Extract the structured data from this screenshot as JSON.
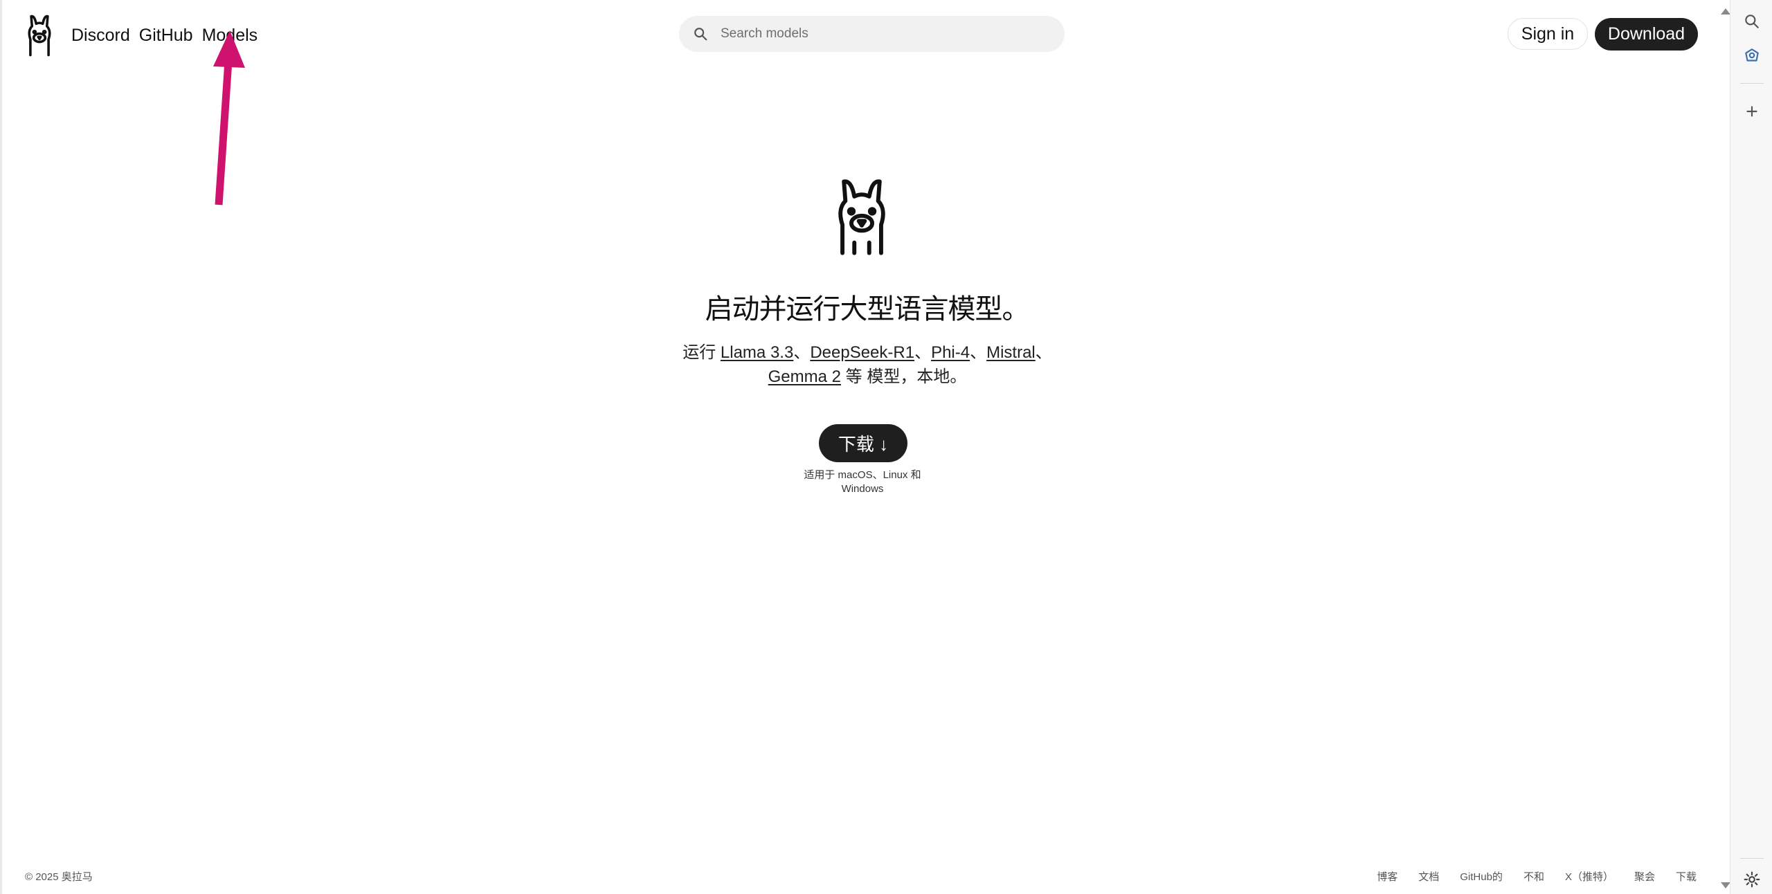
{
  "header": {
    "nav": [
      "Discord",
      "GitHub",
      "Models"
    ],
    "search_placeholder": "Search models",
    "signin_label": "Sign in",
    "download_label": "Download"
  },
  "hero": {
    "headline": "启动并运行大型语言模型。",
    "run_prefix": "运行 ",
    "models": [
      "Llama 3.3",
      "DeepSeek-R1",
      "Phi-4",
      "Mistral",
      "Gemma 2"
    ],
    "separator": "、",
    "run_suffix": " 等 模型，本地。",
    "download_button": "下载 ↓",
    "platforms_line1": "适用于 macOS、Linux 和",
    "platforms_line2": "Windows"
  },
  "footer": {
    "copyright": "© 2025 奥拉马",
    "links": [
      "博客",
      "文档",
      "GitHub的",
      "不和",
      "X（推特）",
      "聚会",
      "下载"
    ]
  },
  "annotation": {
    "arrow_color": "#d0126f"
  },
  "colors": {
    "button_dark": "#1f1f1f",
    "search_bg": "#f1f1f1"
  },
  "icons": [
    "ollama-logo-icon",
    "search-icon",
    "sidebar-search-icon",
    "copilot-icon",
    "plus-icon",
    "settings-icon"
  ]
}
